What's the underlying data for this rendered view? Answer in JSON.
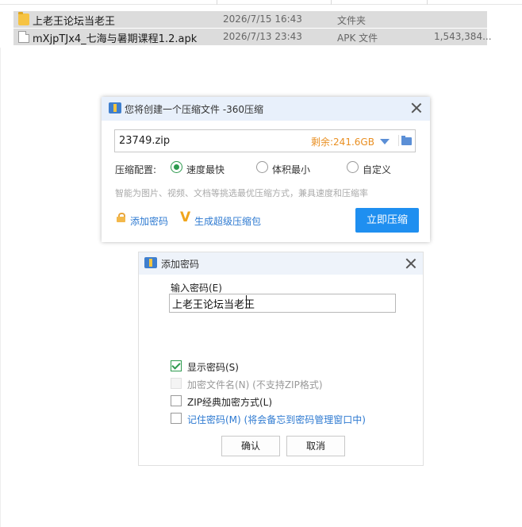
{
  "files": [
    {
      "name": "上老王论坛当老王",
      "date": "2026/7/15 16:43",
      "type": "文件夹",
      "size": "",
      "icon": "folder-icon"
    },
    {
      "name": "mXjpTJx4_七海与暑期课程1.2.apk",
      "date": "2026/7/13 23:43",
      "type": "APK 文件",
      "size": "1,543,384...",
      "icon": "apk-file-icon"
    }
  ],
  "compress_dialog": {
    "title": "您将创建一个压缩文件 -360压缩",
    "filename": "23749.zip",
    "free_space": "剩余:241.6GB",
    "config_label": "压缩配置:",
    "options": [
      "速度最快",
      "体积最小",
      "自定义"
    ],
    "selected_option": "速度最快",
    "hint": "智能为图片、视频、文档等挑选最优压缩方式，兼具速度和压缩率",
    "add_password": "添加密码",
    "super_package": "生成超级压缩包",
    "compress_now": "立即压缩",
    "accent_color": "#1f8ff0"
  },
  "password_dialog": {
    "title": "添加密码",
    "input_label": "输入密码(E)",
    "password_value": "上老王论坛当老王",
    "checkboxes": [
      {
        "label": "显示密码(S)",
        "checked": true,
        "disabled": false
      },
      {
        "label": "加密文件名(N) (不支持ZIP格式)",
        "checked": false,
        "disabled": true
      },
      {
        "label": "ZIP经典加密方式(L)",
        "checked": false,
        "disabled": false
      },
      {
        "label": "记住密码(M) (将会备忘到密码管理窗口中)",
        "checked": false,
        "disabled": false
      }
    ],
    "ok": "确认",
    "cancel": "取消"
  }
}
